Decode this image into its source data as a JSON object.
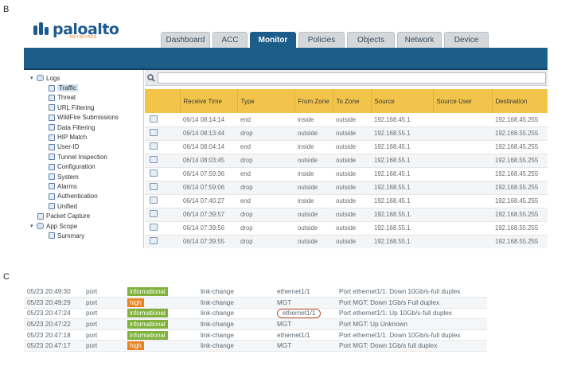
{
  "labels": {
    "section_b": "B",
    "section_c": "C"
  },
  "brand": {
    "name": "paloalto",
    "sub": "NETWORKS"
  },
  "tabs": [
    {
      "label": "Dashboard",
      "active": false
    },
    {
      "label": "ACC",
      "active": false
    },
    {
      "label": "Monitor",
      "active": true
    },
    {
      "label": "Policies",
      "active": false
    },
    {
      "label": "Objects",
      "active": false
    },
    {
      "label": "Network",
      "active": false
    },
    {
      "label": "Device",
      "active": false
    }
  ],
  "sidebar": {
    "items": [
      {
        "label": "Logs",
        "level": 0,
        "expanded": true,
        "icon": "folder-icon"
      },
      {
        "label": "Traffic",
        "level": 1,
        "selected": true,
        "icon": "log-icon"
      },
      {
        "label": "Threat",
        "level": 1,
        "icon": "log-icon"
      },
      {
        "label": "URL Filtering",
        "level": 1,
        "icon": "log-icon"
      },
      {
        "label": "WildFire Submissions",
        "level": 1,
        "icon": "log-icon"
      },
      {
        "label": "Data Filtering",
        "level": 1,
        "icon": "log-icon"
      },
      {
        "label": "HIP Match",
        "level": 1,
        "icon": "log-icon"
      },
      {
        "label": "User-ID",
        "level": 1,
        "icon": "log-icon"
      },
      {
        "label": "Tunnel Inspection",
        "level": 1,
        "icon": "log-icon"
      },
      {
        "label": "Configuration",
        "level": 1,
        "icon": "log-icon"
      },
      {
        "label": "System",
        "level": 1,
        "icon": "log-icon"
      },
      {
        "label": "Alarms",
        "level": 1,
        "icon": "log-icon"
      },
      {
        "label": "Authentication",
        "level": 1,
        "icon": "log-icon"
      },
      {
        "label": "Unified",
        "level": 1,
        "icon": "log-icon"
      },
      {
        "label": "Packet Capture",
        "level": 0,
        "icon": "capture-icon"
      },
      {
        "label": "App Scope",
        "level": 0,
        "expanded": true,
        "icon": "folder-icon"
      },
      {
        "label": "Summary",
        "level": 1,
        "icon": "log-icon"
      }
    ]
  },
  "search": {
    "value": "",
    "placeholder": ""
  },
  "traffic_table": {
    "columns": [
      "",
      "Receive Time",
      "Type",
      "From Zone",
      "To Zone",
      "Source",
      "Source User",
      "Destination"
    ],
    "rows": [
      [
        "06/14 08:14:14",
        "end",
        "inside",
        "outside",
        "192.168.45.1",
        "",
        "192.168.45.255"
      ],
      [
        "06/14 08:13:44",
        "drop",
        "outside",
        "outside",
        "192.168.55.1",
        "",
        "192.168.55.255"
      ],
      [
        "06/14 08:04:14",
        "end",
        "inside",
        "outside",
        "192.168.45.1",
        "",
        "192.168.45.255"
      ],
      [
        "06/14 08:03:45",
        "drop",
        "outside",
        "outside",
        "192.168.55.1",
        "",
        "192.168.55.255"
      ],
      [
        "06/14 07:59:36",
        "end",
        "inside",
        "outside",
        "192.168.45.1",
        "",
        "192.168.45.255"
      ],
      [
        "06/14 07:59:06",
        "drop",
        "outside",
        "outside",
        "192.168.55.1",
        "",
        "192.168.55.255"
      ],
      [
        "06/14 07:40:27",
        "end",
        "inside",
        "outside",
        "192.168.45.1",
        "",
        "192.168.45.255"
      ],
      [
        "06/14 07:39:57",
        "drop",
        "outside",
        "outside",
        "192.168.55.1",
        "",
        "192.168.55.255"
      ],
      [
        "06/14 07:39:56",
        "drop",
        "outside",
        "outside",
        "192.168.55.1",
        "",
        "192.168.55.255"
      ],
      [
        "06/14 07:39:55",
        "drop",
        "outside",
        "outside",
        "192.168.55.1",
        "",
        "192.168.55.255"
      ]
    ]
  },
  "system_log": {
    "rows": [
      {
        "time": "05/23 20:49:30",
        "type": "port",
        "severity": "informational",
        "event": "link-change",
        "object": "ethernet1/1",
        "description": "Port ethernet1/1: Down 10Gb/s-full duplex",
        "circled": false
      },
      {
        "time": "05/23 20:49:29",
        "type": "port",
        "severity": "high",
        "event": "link-change",
        "object": "MGT",
        "description": "Port MGT: Down 1Gb/s Full duplex",
        "circled": false
      },
      {
        "time": "05/23 20:47:24",
        "type": "port",
        "severity": "informational",
        "event": "link-change",
        "object": "ethernet1/1",
        "description": "Port ethernet1/1: Up 10Gb/s-full duplex",
        "circled": true
      },
      {
        "time": "05/23 20:47:22",
        "type": "port",
        "severity": "informational",
        "event": "link-change",
        "object": "MGT",
        "description": "Port MGT: Up Unknown",
        "circled": false
      },
      {
        "time": "05/23 20:47:18",
        "type": "port",
        "severity": "informational",
        "event": "link-change",
        "object": "ethernet1/1",
        "description": "Port ethernet1/1: Down 10Gb/s-full duplex",
        "circled": false
      },
      {
        "time": "05/23 20:47:17",
        "type": "port",
        "severity": "high",
        "event": "link-change",
        "object": "MGT",
        "description": "Port MGT: Down 1Gb/s full duplex",
        "circled": false
      }
    ]
  },
  "colors": {
    "brand_blue": "#1d5d8a",
    "header_yellow": "#f2c54a",
    "severity_informational": "#7fb13c",
    "severity_high": "#e8831f",
    "highlight_circle": "#c0502c"
  }
}
